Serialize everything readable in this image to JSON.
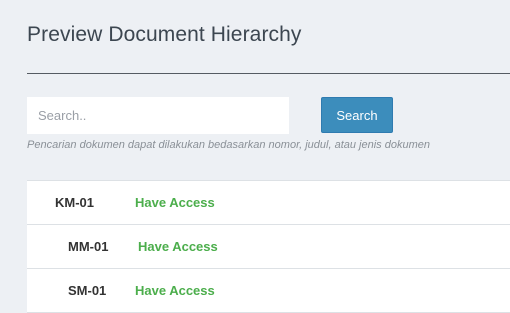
{
  "page": {
    "title": "Preview Document Hierarchy"
  },
  "search": {
    "placeholder": "Search..",
    "value": "",
    "button_label": "Search",
    "helper_text": "Pencarian dokumen dapat dilakukan bedasarkan nomor, judul, atau jenis dokumen"
  },
  "documents": [
    {
      "code": "KM-01",
      "access": "Have Access"
    },
    {
      "code": "MM-01",
      "access": "Have Access"
    },
    {
      "code": "SM-01",
      "access": "Have Access"
    }
  ],
  "colors": {
    "primary_button": "#3c8dbc",
    "access_green": "#4cae4c",
    "background": "#edf0f4"
  }
}
